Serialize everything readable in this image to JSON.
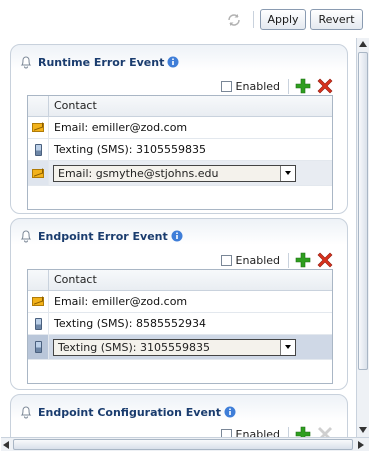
{
  "toolbar": {
    "apply_label": "Apply",
    "revert_label": "Revert",
    "refresh_icon": "refresh-icon"
  },
  "common": {
    "enabled_label": "Enabled",
    "contact_header": "Contact"
  },
  "panels": [
    {
      "title": "Runtime Error Event",
      "rows": [
        {
          "icon": "email-icon",
          "text": "Email: emiller@zod.com"
        },
        {
          "icon": "phone-icon",
          "text": "Texting (SMS): 3105559835"
        },
        {
          "icon": "email-icon",
          "text": "Email: gsmythe@stjohns.edu"
        }
      ]
    },
    {
      "title": "Endpoint Error Event",
      "rows": [
        {
          "icon": "email-icon",
          "text": "Email: emiller@zod.com"
        },
        {
          "icon": "phone-icon",
          "text": "Texting (SMS): 8585552934"
        },
        {
          "icon": "phone-icon",
          "text": "Texting (SMS): 3105559835"
        }
      ]
    },
    {
      "title": "Endpoint Configuration Event",
      "rows": []
    }
  ],
  "colors": {
    "title": "#1a3c6e",
    "add": "#2e9e1f",
    "delete": "#d8321e"
  }
}
